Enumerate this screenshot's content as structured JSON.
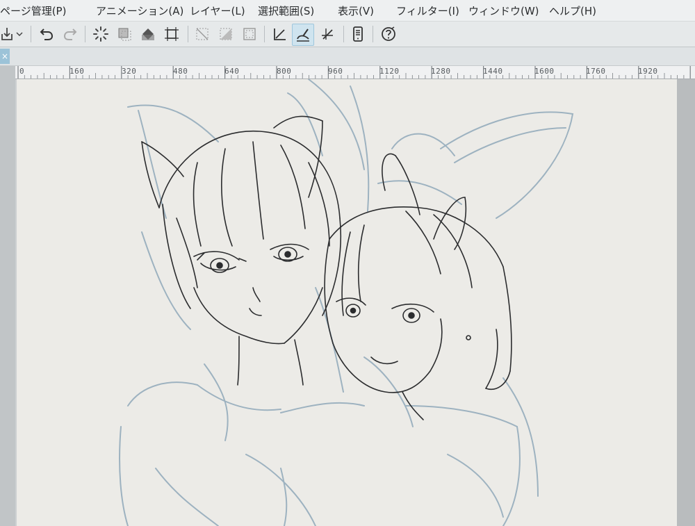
{
  "menu": {
    "items": [
      {
        "label": "ページ管理(P)"
      },
      {
        "label": "アニメーション(A)"
      },
      {
        "label": "レイヤー(L)"
      },
      {
        "label": "選択範囲(S)"
      },
      {
        "label": "表示(V)"
      },
      {
        "label": "フィルター(I)"
      },
      {
        "label": "ウィンドウ(W)"
      },
      {
        "label": "ヘルプ(H)"
      }
    ]
  },
  "toolbar": {
    "icons": [
      "import-icon",
      "dropdown-arrow-icon",
      "undo-icon",
      "redo-icon",
      "loading-icon",
      "clear-layer-icon",
      "fill-icon",
      "transform-icon",
      "deselect-icon",
      "invert-selection-icon",
      "selection-border-icon",
      "ruler-snap-icon",
      "special-ruler-snap-icon",
      "grid-snap-icon",
      "smartphone-icon",
      "help-icon"
    ],
    "active_tool": "special-ruler-snap-icon"
  },
  "tab": {
    "close_label": "×"
  },
  "ruler": {
    "labels": [
      "0",
      "160",
      "320",
      "480",
      "640",
      "800",
      "960",
      "1120",
      "1280",
      "1440",
      "1600",
      "1760",
      "1920"
    ]
  },
  "colors": {
    "accent": "#9cc3d8",
    "paper": "#ecebe7",
    "ink": "#2b2c2e",
    "rough_sketch": "#9db2c0"
  }
}
